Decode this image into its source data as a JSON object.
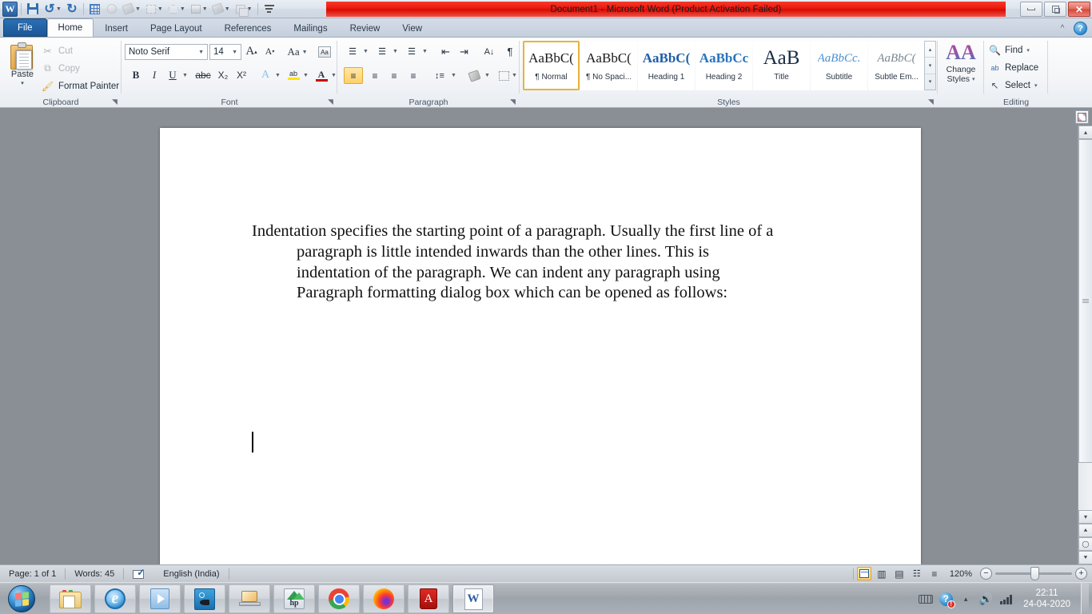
{
  "window": {
    "title": "Document1  -  Microsoft Word (Product Activation Failed)",
    "app_logo": "W",
    "minimize_label": "Minimize",
    "restore_label": "Restore Down",
    "close_label": "✕"
  },
  "quick_access": {
    "items": [
      {
        "name": "save-icon",
        "label": "Save"
      },
      {
        "name": "undo-icon",
        "label": "↺"
      },
      {
        "name": "undo-dropdown-icon",
        "label": "▾"
      },
      {
        "name": "redo-icon",
        "label": "↻"
      },
      {
        "name": "grid-icon",
        "label": "Gridlines"
      },
      {
        "name": "shape-effects-icon",
        "label": "Shape Effects"
      },
      {
        "name": "shape-fill-icon",
        "label": "Shape Fill"
      },
      {
        "name": "shape-fill-dropdown-icon",
        "label": "▾"
      },
      {
        "name": "object-rotate-icon",
        "label": "Rotate"
      },
      {
        "name": "object-rotate-dropdown-icon",
        "label": "▾"
      },
      {
        "name": "edit-points-icon",
        "label": "Edit Points"
      },
      {
        "name": "edit-points-dropdown-icon",
        "label": "▾"
      },
      {
        "name": "gradient-icon",
        "label": "Gradient"
      },
      {
        "name": "gradient-dropdown-icon",
        "label": "▾"
      },
      {
        "name": "fill-color-icon",
        "label": "Fill Color"
      },
      {
        "name": "fill-color-dropdown-icon",
        "label": "▾"
      },
      {
        "name": "arrange-icon",
        "label": "Arrange"
      },
      {
        "name": "arrange-dropdown-icon",
        "label": "▾"
      },
      {
        "name": "customize-qat-icon",
        "label": "▾"
      }
    ]
  },
  "ribbon": {
    "tabs": [
      {
        "id": "file",
        "label": "File"
      },
      {
        "id": "home",
        "label": "Home"
      },
      {
        "id": "insert",
        "label": "Insert"
      },
      {
        "id": "page-layout",
        "label": "Page Layout"
      },
      {
        "id": "references",
        "label": "References"
      },
      {
        "id": "mailings",
        "label": "Mailings"
      },
      {
        "id": "review",
        "label": "Review"
      },
      {
        "id": "view",
        "label": "View"
      }
    ],
    "active_tab": "Home",
    "minimize_ribbon_icon": "^",
    "help_icon": "?",
    "groups": {
      "clipboard": {
        "label": "Clipboard",
        "paste": "Paste",
        "paste_caret": "▾",
        "cut": "Cut",
        "copy": "Copy",
        "format_painter": "Format Painter",
        "launcher": "◥"
      },
      "font": {
        "label": "Font",
        "font_name": "Noto Serif",
        "font_size": "14",
        "grow_font": "A",
        "shrink_font": "A",
        "change_case": "Aa",
        "clear_formatting": "A",
        "bold": "B",
        "italic": "I",
        "underline": "U",
        "strikethrough": "abc",
        "subscript": "X₂",
        "superscript": "X²",
        "text_effects": "A",
        "highlight": "ab",
        "font_color": "A",
        "launcher": "◥"
      },
      "paragraph": {
        "label": "Paragraph",
        "bullets": "☰",
        "numbering": "☰",
        "multilevel": "☰",
        "decrease_indent": "⇤",
        "increase_indent": "⇥",
        "sort": "A↓",
        "show_marks": "¶",
        "align_left": "≡",
        "align_center": "≡",
        "align_right": "≡",
        "justify": "≡",
        "line_spacing": "↕",
        "shading": "▨",
        "borders": "▦",
        "launcher": "◥"
      },
      "styles": {
        "label": "Styles",
        "items": [
          {
            "sample": "AaBbC(",
            "name": "¶ Normal",
            "selected": true,
            "color": "#1a1a1a",
            "weight": "normal",
            "style": "normal"
          },
          {
            "sample": "AaBbC(",
            "name": "¶ No Spaci...",
            "selected": false,
            "color": "#1a1a1a",
            "weight": "normal",
            "style": "normal"
          },
          {
            "sample": "AaBbC(",
            "name": "Heading 1",
            "selected": false,
            "color": "#1f5fa8",
            "weight": "bold",
            "style": "normal"
          },
          {
            "sample": "AaBbCc",
            "name": "Heading 2",
            "selected": false,
            "color": "#2a74bd",
            "weight": "bold",
            "style": "normal"
          },
          {
            "sample": "AaB",
            "name": "Title",
            "selected": false,
            "color": "#1a2d44",
            "weight": "normal",
            "style": "normal"
          },
          {
            "sample": "AaBbCc.",
            "name": "Subtitle",
            "selected": false,
            "color": "#4a8fd0",
            "weight": "normal",
            "style": "italic"
          },
          {
            "sample": "AaBbC(",
            "name": "Subtle Em...",
            "selected": false,
            "color": "#7a8592",
            "weight": "normal",
            "style": "italic"
          }
        ],
        "scroll_up": "▴",
        "scroll_down": "▾",
        "more": "▾",
        "launcher": "◥"
      },
      "change_styles": {
        "label": "Change\nStyles",
        "line1": "Change",
        "line2": "Styles",
        "caret": "▾",
        "icon": "AA"
      },
      "editing": {
        "label": "Editing",
        "find": "Find",
        "find_caret": "▾",
        "replace": "Replace",
        "select": "Select",
        "select_caret": "▾"
      }
    }
  },
  "document": {
    "paragraph_lines": [
      "Indentation specifies the starting point of a paragraph. Usually the first line of a",
      "paragraph is little intended inwards than the other lines. This is",
      "indentation of the paragraph. We can indent any paragraph using",
      "Paragraph formatting dialog box which can be opened as follows:"
    ],
    "ruler_toggle_label": "View Ruler"
  },
  "scrollbar": {
    "up_arrow": "▴",
    "down_arrow": "▾",
    "previous_page": "⯅",
    "select_browse_object": "◯",
    "next_page": "⯆"
  },
  "status_bar": {
    "page": "Page: 1 of 1",
    "words": "Words: 45",
    "proofing_label": "Proofing errors",
    "language": "English (India)",
    "views": [
      {
        "name": "print-layout-view",
        "glyph": "▤",
        "active": true
      },
      {
        "name": "full-screen-reading-view",
        "glyph": "▥",
        "active": false
      },
      {
        "name": "web-layout-view",
        "glyph": "▤",
        "active": false
      },
      {
        "name": "outline-view",
        "glyph": "▤",
        "active": false
      },
      {
        "name": "draft-view",
        "glyph": "▤",
        "active": false
      }
    ],
    "zoom": "120%",
    "zoom_out": "−",
    "zoom_in": "+"
  },
  "taskbar": {
    "start_label": "Start",
    "items": [
      {
        "name": "windows-explorer",
        "label": "Windows Explorer",
        "active": false
      },
      {
        "name": "internet-explorer",
        "label": "Internet Explorer",
        "active": false
      },
      {
        "name": "windows-media-player",
        "label": "Windows Media Player",
        "active": false
      },
      {
        "name": "aquarium-app",
        "label": "Aquarium",
        "active": false
      },
      {
        "name": "laptop-utility",
        "label": "Laptop Utility",
        "active": false
      },
      {
        "name": "hp-support-assistant",
        "label": "HP",
        "active": false
      },
      {
        "name": "google-chrome",
        "label": "Google Chrome",
        "active": false
      },
      {
        "name": "mozilla-firefox",
        "label": "Mozilla Firefox",
        "active": false
      },
      {
        "name": "adobe-reader",
        "label": "Adobe Reader",
        "active": false
      },
      {
        "name": "microsoft-word",
        "label": "Microsoft Word",
        "active": true
      }
    ],
    "tray": {
      "keyboard_icon": "keyboard",
      "action_center_icon": "?",
      "action_center_badge": "!",
      "show_hidden_icon": "▴",
      "volume_icon": "🔊",
      "network_icon": "network",
      "time": "22:11",
      "date": "24-04-2020"
    }
  }
}
